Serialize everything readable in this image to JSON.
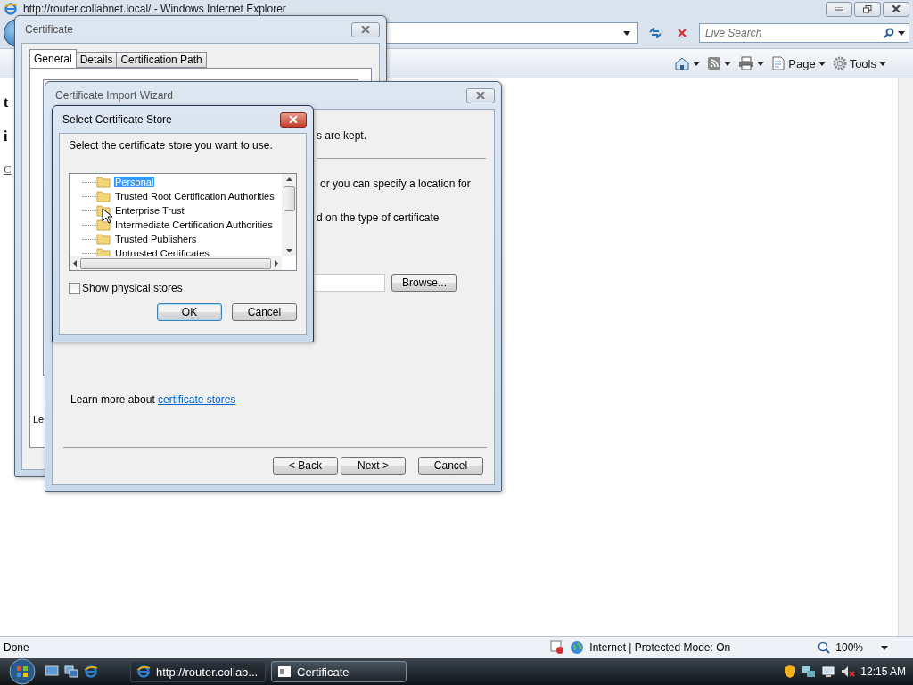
{
  "browser": {
    "title": "http://router.collabnet.local/ - Windows Internet Explorer",
    "search_placeholder": "Live Search",
    "commands": [
      {
        "kind": "home"
      },
      {
        "kind": "feeds"
      },
      {
        "kind": "print"
      },
      {
        "kind": "page",
        "label": "Page"
      },
      {
        "kind": "tools",
        "label": "Tools"
      }
    ],
    "page_fragments": [
      {
        "kind": "heading",
        "text": "t"
      },
      {
        "kind": "heading",
        "text": "i"
      },
      {
        "kind": "link",
        "text": "C"
      }
    ]
  },
  "status_bar": {
    "text": "Done",
    "zone": "Internet | Protected Mode: On",
    "zoom": "100%"
  },
  "certificate_window": {
    "title": "Certificate",
    "tabs": [
      {
        "label": "General",
        "selected": true
      },
      {
        "label": "Details",
        "selected": false
      },
      {
        "label": "Certification Path",
        "selected": false
      }
    ],
    "fragment": "Le"
  },
  "import_wizard": {
    "title": "Certificate Import Wizard",
    "fragments": [
      "s are kept.",
      "or you can specify a location for",
      "d on the type of certificate"
    ],
    "browse": "Browse...",
    "learn_more": "Learn more about ",
    "learn_more_link": "certificate stores",
    "buttons": [
      "< Back",
      "Next >",
      "Cancel"
    ]
  },
  "store_dialog": {
    "title": "Select Certificate Store",
    "prompt": "Select the certificate store you want to use.",
    "stores": [
      {
        "label": "Personal",
        "selected": true
      },
      {
        "label": "Trusted Root Certification Authorities",
        "selected": false
      },
      {
        "label": "Enterprise Trust",
        "selected": false
      },
      {
        "label": "Intermediate Certification Authorities",
        "selected": false
      },
      {
        "label": "Trusted Publishers",
        "selected": false
      },
      {
        "label": "Untrusted Certificates",
        "selected": false
      }
    ],
    "show_physical": {
      "label": "Show physical stores",
      "checked": false
    },
    "buttons": [
      {
        "label": "OK",
        "default": true
      },
      {
        "label": "Cancel",
        "default": false
      }
    ]
  },
  "taskbar": {
    "buttons": [
      {
        "label": "http://router.collab...",
        "selected": false
      },
      {
        "label": "Certificate",
        "selected": true
      }
    ],
    "clock": "12:15 AM"
  }
}
